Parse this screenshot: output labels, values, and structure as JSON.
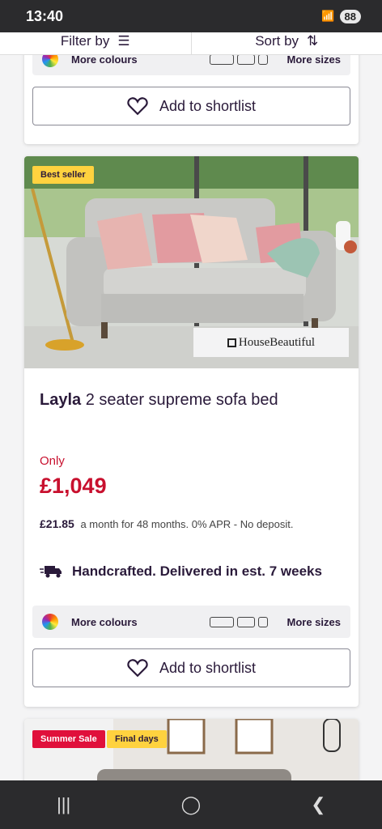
{
  "status_bar": {
    "time": "13:40",
    "battery": "88"
  },
  "toolbar": {
    "filter_label": "Filter by",
    "sort_label": "Sort by"
  },
  "product_prev": {
    "more_colours": "More colours",
    "more_sizes": "More sizes",
    "shortlist_label": "Add to shortlist"
  },
  "product": {
    "badge": "Best seller",
    "image_logo": "HouseBeautiful",
    "name_bold": "Layla",
    "name_rest": " 2 seater supreme sofa bed",
    "price_prefix": "Only",
    "price": "£1,049",
    "finance_amount": "£21.85",
    "finance_terms": "a month for 48 months. 0% APR - No deposit.",
    "delivery_text": "Handcrafted. Delivered in est. 7 weeks",
    "more_colours": "More colours",
    "more_sizes": "More sizes",
    "shortlist_label": "Add to shortlist"
  },
  "product_next": {
    "badge_sale": "Summer Sale",
    "badge_final": "Final days"
  },
  "colors": {
    "accent": "#c8102e",
    "brand_text": "#2a1a3a",
    "badge_yellow": "#ffd23f",
    "badge_red": "#e0103b"
  }
}
